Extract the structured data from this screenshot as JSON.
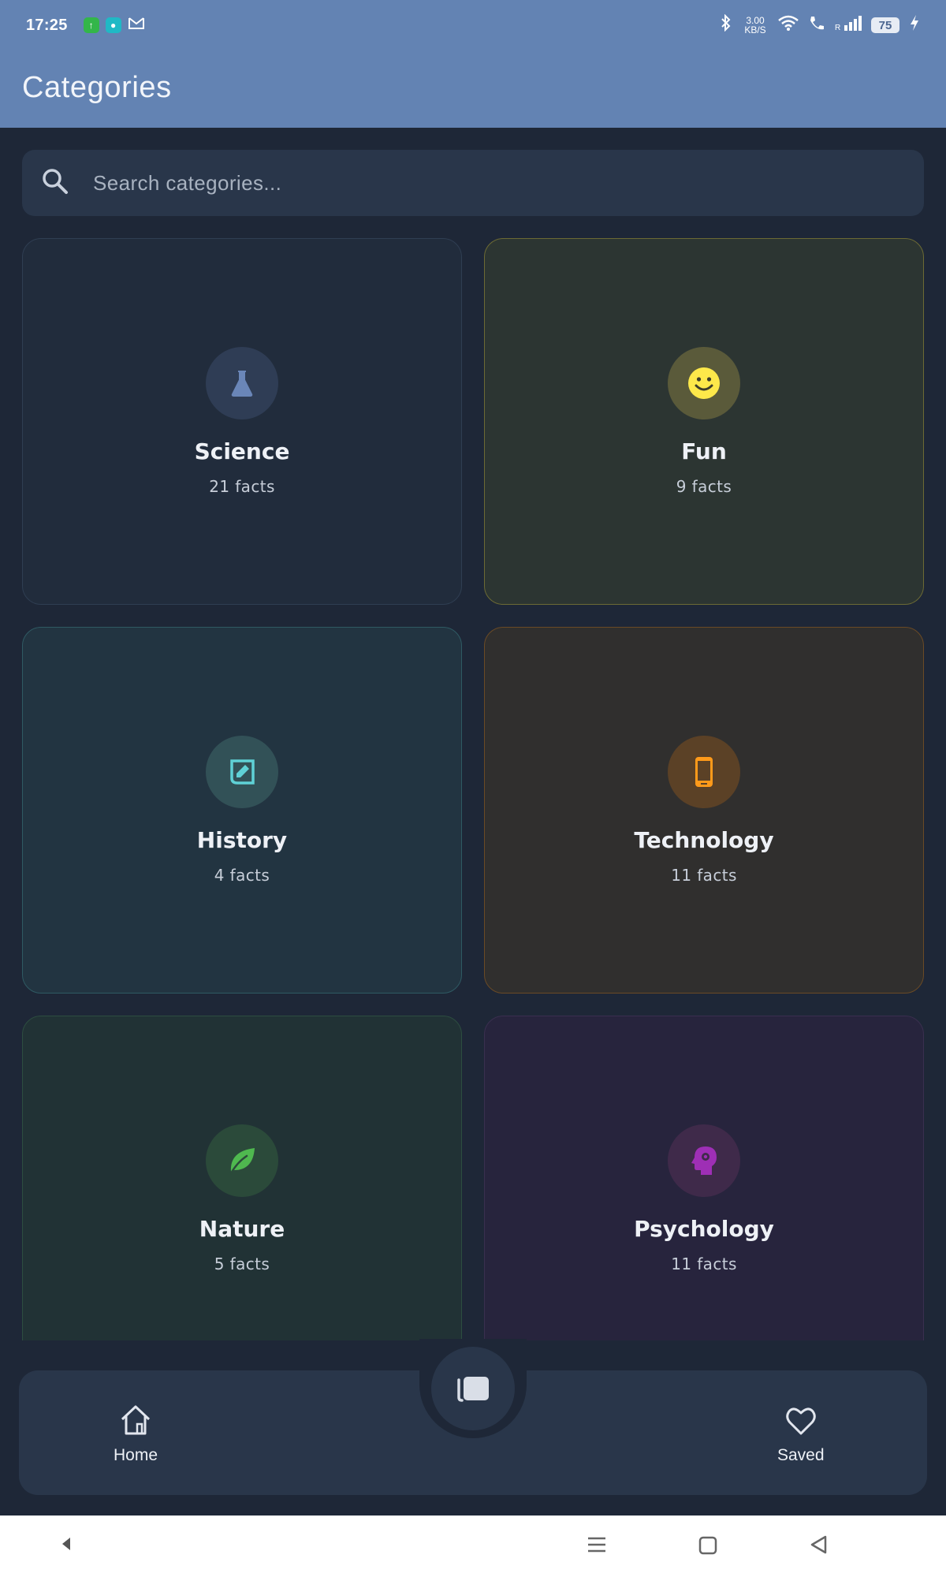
{
  "status_bar": {
    "time": "17:25",
    "notification_icons": [
      "upload-icon",
      "chat-app-icon",
      "gmail-icon"
    ],
    "net_speed": "3.00 KB/S",
    "battery": "75",
    "icons": [
      "bluetooth-icon",
      "wifi-icon",
      "call-icon",
      "signal-icon",
      "charging-icon"
    ]
  },
  "app_bar": {
    "title": "Categories"
  },
  "search": {
    "placeholder": "Search categories...",
    "icon": "search-icon"
  },
  "categories": [
    {
      "name": "Science",
      "count": "21 facts",
      "icon": "flask-icon",
      "accent": "#6a86b8",
      "circle": "#2f3d55",
      "bg": "#212c3c",
      "border": "#2f3e52"
    },
    {
      "name": "Fun",
      "count": "9 facts",
      "icon": "smiley-icon",
      "accent": "#fde84a",
      "circle": "#5a5a3a",
      "bg": "#2c3532",
      "border": "#6c6a34"
    },
    {
      "name": "History",
      "count": "4 facts",
      "icon": "history-edu-icon",
      "accent": "#5fd1d6",
      "circle": "#325157",
      "bg": "#223441",
      "border": "#2f5a63"
    },
    {
      "name": "Technology",
      "count": "11 facts",
      "icon": "smartphone-icon",
      "accent": "#ff9a1a",
      "circle": "#5b4126",
      "bg": "#302f2e",
      "border": "#6a4a25"
    },
    {
      "name": "Nature",
      "count": "5 facts",
      "icon": "leaf-icon",
      "accent": "#4fb84f",
      "circle": "#2b4a3a",
      "bg": "#213235",
      "border": "#2d4d40"
    },
    {
      "name": "Psychology",
      "count": "11 facts",
      "icon": "psychology-icon",
      "accent": "#9e2fb5",
      "circle": "#3f2a4a",
      "bg": "#27243d",
      "border": "#3a2f4f"
    }
  ],
  "bottom_nav": {
    "items": [
      {
        "label": "Home",
        "icon": "home-icon"
      },
      {
        "label": "Saved",
        "icon": "heart-icon"
      }
    ],
    "fab_icon": "cards-icon"
  },
  "system_nav": {
    "icons": [
      "back-triangle-icon",
      "menu-lines-icon",
      "home-square-icon",
      "back-icon"
    ]
  }
}
